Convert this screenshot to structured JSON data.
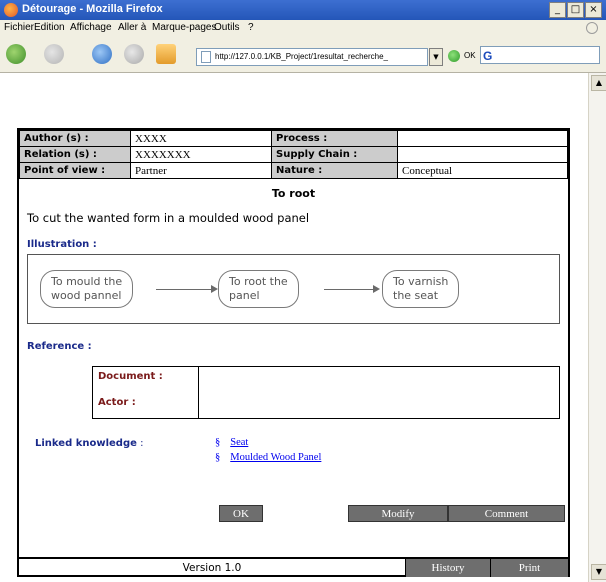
{
  "window": {
    "title": "Détourage - Mozilla Firefox",
    "buttons": [
      "_",
      "□",
      "×"
    ]
  },
  "menu": [
    "Fichier",
    "Edition",
    "Affichage",
    "Aller à",
    "Marque-pages",
    "Outils",
    "?"
  ],
  "toolbar": {
    "url": "http://127.0.0.1/KB_Project/1resultat_recherche_",
    "go_label": "OK",
    "search_value": "G"
  },
  "meta": {
    "author_label": "Author (s) :",
    "author_value": "XXXX",
    "process_label": "Process :",
    "process_value": "",
    "relation_label": "Relation (s) :",
    "relation_value": "XXXXXXX",
    "supply_label": "Supply Chain :",
    "supply_value": "",
    "pov_label": "Point of view :",
    "pov_value": "Partner",
    "nature_label": "Nature :",
    "nature_value": "Conceptual"
  },
  "knowledge": {
    "title": "To root",
    "description": "To cut the wanted form in a moulded wood panel"
  },
  "illustration": {
    "label": "Illustration :",
    "steps": [
      "To mould the\nwood pannel",
      "To root the\npanel",
      "To varnish\nthe seat"
    ]
  },
  "reference": {
    "label": "Reference :",
    "document_label": "Document :",
    "actor_label": "Actor :"
  },
  "linked": {
    "label": "Linked knowledge",
    "colon": " :",
    "items": [
      "Seat",
      "Moulded Wood Panel"
    ],
    "bullet": "§"
  },
  "actions": {
    "ok": "OK",
    "modify": "Modify",
    "comment": "Comment"
  },
  "footer": {
    "version": "Version 1.0",
    "history": "History",
    "print": "Print"
  }
}
